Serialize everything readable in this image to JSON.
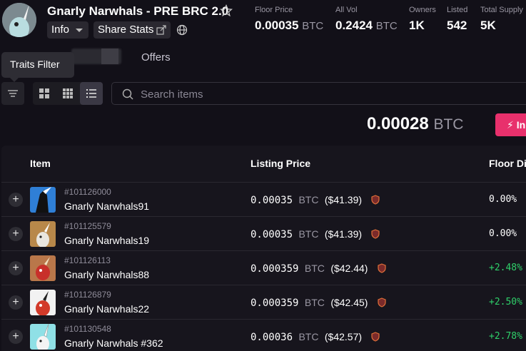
{
  "collection": {
    "title": "Gnarly Narwhals - PRE BRC 2.0",
    "info_label": "Info",
    "share_label": "Share Stats"
  },
  "stats": [
    {
      "label": "Floor Price",
      "value": "0.00035",
      "unit": "BTC"
    },
    {
      "label": "All Vol",
      "value": "0.2424",
      "unit": "BTC"
    },
    {
      "label": "Owners",
      "value": "1K",
      "unit": ""
    },
    {
      "label": "Listed",
      "value": "542",
      "unit": ""
    },
    {
      "label": "Total Supply",
      "value": "5K",
      "unit": ""
    }
  ],
  "tabs": {
    "offers": "Offers"
  },
  "tooltip": "Traits Filter",
  "search": {
    "placeholder": "Search items"
  },
  "summary_price": {
    "value": "0.00028",
    "unit": "BTC"
  },
  "buy_button_label": "In",
  "table": {
    "headers": {
      "item": "Item",
      "listing_price": "Listing Price",
      "floor_diff": "Floor Di"
    },
    "rows": [
      {
        "inscription": "#101126000",
        "name": "Gnarly Narwhals91",
        "price": "0.00035",
        "unit": "BTC",
        "usd": "($41.39)",
        "floor_diff": "0.00%",
        "thumb_bg": "#2f7fd6",
        "thumb_fg": "#111111"
      },
      {
        "inscription": "#101125579",
        "name": "Gnarly Narwhals19",
        "price": "0.00035",
        "unit": "BTC",
        "usd": "($41.39)",
        "floor_diff": "0.00%",
        "thumb_bg": "#b8884a",
        "thumb_fg": "#e9e6df"
      },
      {
        "inscription": "#101126113",
        "name": "Gnarly Narwhals88",
        "price": "0.000359",
        "unit": "BTC",
        "usd": "($42.44)",
        "floor_diff": "+2.48%",
        "thumb_bg": "#b9774a",
        "thumb_fg": "#c8302a"
      },
      {
        "inscription": "#101126879",
        "name": "Gnarly Narwhals22",
        "price": "0.000359",
        "unit": "BTC",
        "usd": "($42.45)",
        "floor_diff": "+2.50%",
        "thumb_bg": "#f2f2f2",
        "thumb_fg": "#d23a2a"
      },
      {
        "inscription": "#101130548",
        "name": "Gnarly Narwhals #362",
        "price": "0.00036",
        "unit": "BTC",
        "usd": "($42.57)",
        "floor_diff": "+2.78%",
        "thumb_bg": "#8fe0e6",
        "thumb_fg": "#f4f4f4"
      }
    ]
  },
  "colors": {
    "positive": "#2fd06a",
    "neutral": "#ffffff",
    "accent": "#e8306c"
  }
}
